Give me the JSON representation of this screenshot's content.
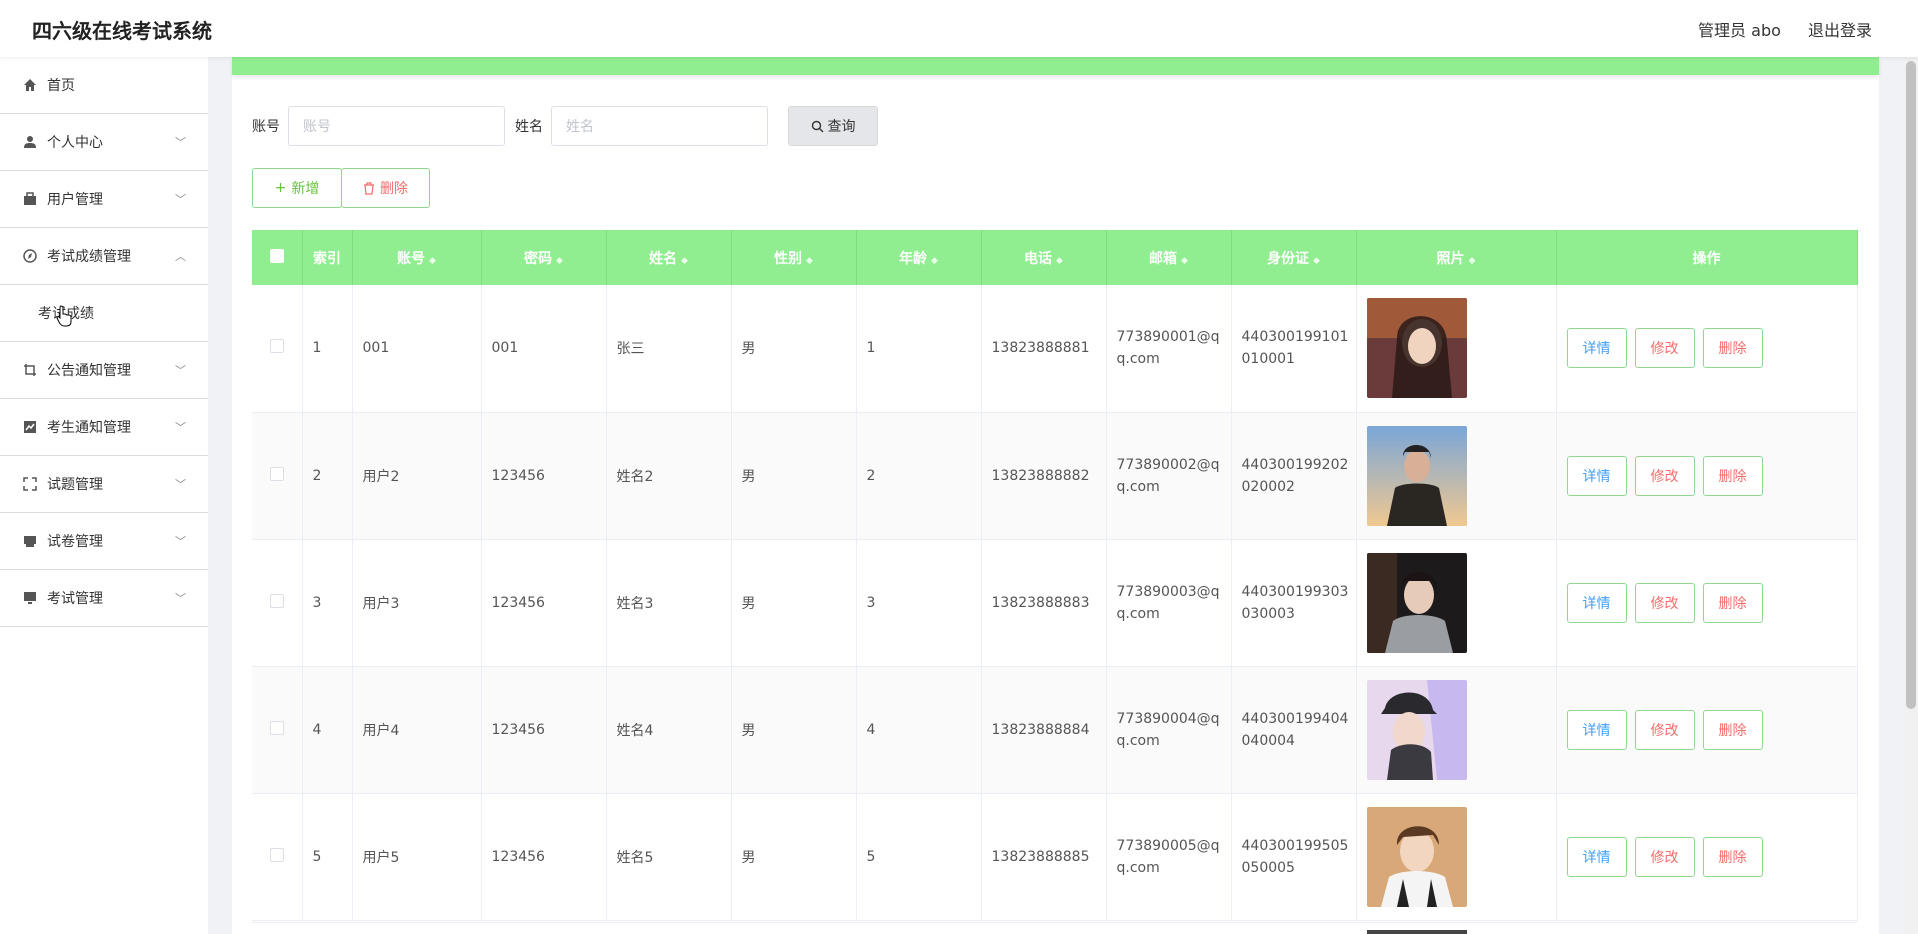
{
  "header": {
    "app_title": "四六级在线考试系统",
    "user_label": "管理员 abo",
    "logout_label": "退出登录"
  },
  "sidebar": {
    "items": [
      {
        "label": "首页",
        "icon": "home-icon"
      },
      {
        "label": "个人中心",
        "icon": "user-icon"
      },
      {
        "label": "用户管理",
        "icon": "users-icon"
      },
      {
        "label": "考试成绩管理",
        "icon": "compass-icon"
      },
      {
        "label": "考试成绩",
        "icon": ""
      },
      {
        "label": "公告通知管理",
        "icon": "crop-icon"
      },
      {
        "label": "考生通知管理",
        "icon": "chart-icon"
      },
      {
        "label": "试题管理",
        "icon": "fullscreen-icon"
      },
      {
        "label": "试卷管理",
        "icon": "printer-icon"
      },
      {
        "label": "考试管理",
        "icon": "monitor-icon"
      }
    ]
  },
  "search": {
    "account_label": "账号",
    "account_placeholder": "账号",
    "name_label": "姓名",
    "name_placeholder": "姓名",
    "query_label": "查询"
  },
  "actions": {
    "add_label": "新增",
    "delete_label": "删除"
  },
  "table": {
    "headers": [
      "索引",
      "账号",
      "密码",
      "姓名",
      "性别",
      "年龄",
      "电话",
      "邮箱",
      "身份证",
      "照片",
      "操作"
    ],
    "rows": [
      {
        "index": "1",
        "account": "001",
        "password": "001",
        "name": "张三",
        "gender": "男",
        "age": "1",
        "phone": "13823888881",
        "email_line1": "773890001@q",
        "email_line2": "q.com",
        "id_line1": "440300199101",
        "id_line2": "010001"
      },
      {
        "index": "2",
        "account": "用户2",
        "password": "123456",
        "name": "姓名2",
        "gender": "男",
        "age": "2",
        "phone": "13823888882",
        "email_line1": "773890002@q",
        "email_line2": "q.com",
        "id_line1": "440300199202",
        "id_line2": "020002"
      },
      {
        "index": "3",
        "account": "用户3",
        "password": "123456",
        "name": "姓名3",
        "gender": "男",
        "age": "3",
        "phone": "13823888883",
        "email_line1": "773890003@q",
        "email_line2": "q.com",
        "id_line1": "440300199303",
        "id_line2": "030003"
      },
      {
        "index": "4",
        "account": "用户4",
        "password": "123456",
        "name": "姓名4",
        "gender": "男",
        "age": "4",
        "phone": "13823888884",
        "email_line1": "773890004@q",
        "email_line2": "q.com",
        "id_line1": "440300199404",
        "id_line2": "040004"
      },
      {
        "index": "5",
        "account": "用户5",
        "password": "123456",
        "name": "姓名5",
        "gender": "男",
        "age": "5",
        "phone": "13823888885",
        "email_line1": "773890005@q",
        "email_line2": "q.com",
        "id_line1": "440300199505",
        "id_line2": "050005"
      }
    ],
    "op_detail": "详情",
    "op_edit": "修改",
    "op_delete": "删除"
  },
  "colors": {
    "accent_green": "#90ee90",
    "danger": "#f56c6c",
    "primary": "#409eff"
  }
}
